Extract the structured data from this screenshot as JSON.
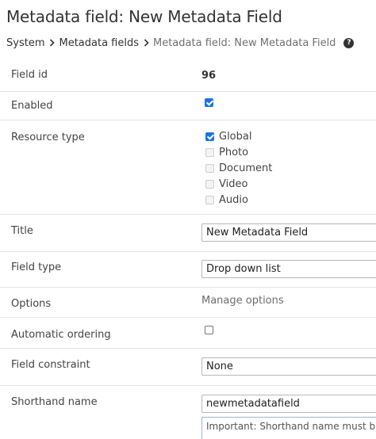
{
  "page": {
    "title": "Metadata field: New Metadata Field"
  },
  "breadcrumb": {
    "items": [
      "System",
      "Metadata fields"
    ],
    "current": "Metadata field: New Metadata Field",
    "help_glyph": "?"
  },
  "form": {
    "field_id": {
      "label": "Field id",
      "value": "96"
    },
    "enabled": {
      "label": "Enabled",
      "checked": true
    },
    "resource_type": {
      "label": "Resource type",
      "options": [
        {
          "label": "Global",
          "checked": true,
          "disabled": false
        },
        {
          "label": "Photo",
          "checked": false,
          "disabled": true
        },
        {
          "label": "Document",
          "checked": false,
          "disabled": true
        },
        {
          "label": "Video",
          "checked": false,
          "disabled": true
        },
        {
          "label": "Audio",
          "checked": false,
          "disabled": true
        }
      ]
    },
    "title": {
      "label": "Title",
      "value": "New Metadata Field"
    },
    "field_type": {
      "label": "Field type",
      "value": "Drop down list"
    },
    "options": {
      "label": "Options",
      "link": "Manage options"
    },
    "automatic_ordering": {
      "label": "Automatic ordering",
      "checked": false
    },
    "field_constraint": {
      "label": "Field constraint",
      "value": "None"
    },
    "shorthand_name": {
      "label": "Shorthand name",
      "value": "newmetadatafield",
      "note": "Important: Shorthand name must b"
    }
  },
  "colors": {
    "accent": "#1a73e8",
    "text": "#444444",
    "divider": "#e4e4e4"
  }
}
